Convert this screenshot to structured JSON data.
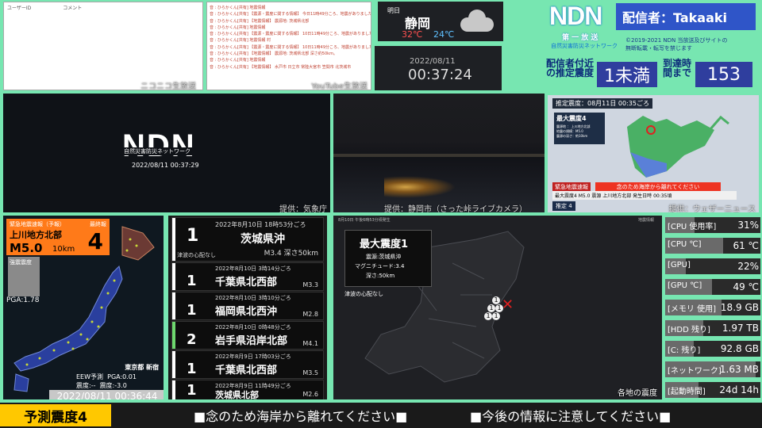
{
  "comments": {
    "headers": [
      "ユーザーID",
      "コメント"
    ],
    "lines": [
      "音 : ひらかくん[共有] 地震情報",
      "音 : ひらかくん[共有] 【震源・震度に関する情報】 今日11時49分ころ、地震がありました。この地震による津波の心配はありません。",
      "音 : ひらかくん[共有] 【地震情報】 震源地: 茨城県北部",
      "音 : ひらかくん[共有] 地震情報",
      "音 : ひらかくん[共有] 【震源・震度に関する情報】 10日11時49分ころ、地震がありました。",
      "音 : ひらかくん[共有] 地震情報 村",
      "音 : ひらかくん[共有] 【震源・震度に関する情報】 10日11時49分ころ、地震がありました。",
      "音 : ひらかくん[共有] 【地震情報】 震源地: 茨城県北部 深さ約50km。",
      "音 : ひらかくん[共有] 地震情報",
      "音 : ひらかくん[共有] 【地震情報】 水戸市 日立市 常陸大宮市 笠間市 北茨城市"
    ],
    "label_niconico": "ニコニコ生放送",
    "label_youtube": "YouTube生放送"
  },
  "weather": {
    "label": "明日",
    "city": "静岡",
    "high": "32℃",
    "low": "24℃"
  },
  "clock": {
    "date": "2022/08/11",
    "time": "00:37:24"
  },
  "ndn": {
    "logo": "NDN",
    "sub": "第 一 放 送",
    "sub2": "自然災害防災ネットワーク",
    "caster": "配信者：Takaaki",
    "copyright1": "©2019-2021 NDN 当放送及びサイトの",
    "copyright2": "無断転載・転写を禁じます",
    "intensity_label": "配信者付近の推定震度",
    "intensity_value": "1未満",
    "arrival_label": "到達時間まで",
    "arrival_value": "153"
  },
  "videos": {
    "ndn_brand": "NDN",
    "ndn_brand_sub": "自然災害防災ネットワーク",
    "ndn_time": "2022/08/11 00:37:29",
    "credit_jma": "提供：気象庁",
    "credit_cam": "提供：静岡市（さった峠ライブカメラ）",
    "credit_wn": "提供：ウェザーニュース"
  },
  "wn_panel": {
    "estimate": "推定震度：08月11日 00:35ごろ",
    "max_label": "最大震度4",
    "line1": "震源地 ： 上川地方北部",
    "line2": "地震の規模：M5.0",
    "line3": "震源の深さ：約10km",
    "banner": "緊急地震速報",
    "msg": "念のため海岸から離れてください",
    "bottom": "最大震度4  M5.0  震源 上川地方北部  発生日時 00:35頃",
    "est": "推定 4"
  },
  "eew": {
    "title": "緊急地震速報（予報）",
    "final": "最終報",
    "area": "上川地方北部",
    "mag": "M5.0",
    "depth": "10km",
    "intensity": "4",
    "int_label": "強震震度",
    "pga": "PGA:1.78",
    "station": "東京都 新宿",
    "eew_pred": "EEW予測",
    "eew_int": "震度:--",
    "pga2": "PGA:0.01",
    "int2": "震度:-3.0",
    "time": "2022/08/11 00:36:44"
  },
  "quakes": [
    {
      "int": "1",
      "date": "2022年8月10日 18時53分ごろ",
      "place": "茨城県沖",
      "mag": "M3.4 深さ50km",
      "note": "津波の心配なし",
      "bar": "#ffffff"
    },
    {
      "int": "1",
      "date": "2022年8月10日 3時14分ごろ",
      "place": "千葉県北西部",
      "mag": "M3.3",
      "bar": "#ffffff"
    },
    {
      "int": "1",
      "date": "2022年8月10日 3時10分ごろ",
      "place": "福岡県北西沖",
      "mag": "M2.8",
      "bar": "#ffffff"
    },
    {
      "int": "2",
      "date": "2022年8月10日 0時48分ごろ",
      "place": "岩手県沿岸北部",
      "mag": "M4.1",
      "bar": "#6ed86e"
    },
    {
      "int": "1",
      "date": "2022年8月9日 17時03分ごろ",
      "place": "千葉県北西部",
      "mag": "M3.5",
      "bar": "#ffffff"
    },
    {
      "int": "1",
      "date": "2022年8月9日 11時49分ごろ",
      "place": "茨城県北部",
      "mag": "M2.6",
      "bar": "#ffffff"
    }
  ],
  "map": {
    "header": "8月10日 午後6時53分頃発生",
    "header2": "地震情報",
    "max": "最大震度1",
    "epi": "震源:茨城県沖",
    "mag": "マグニチュード:3.4",
    "depth": "深さ:50km",
    "tsunami": "津波の心配なし",
    "footer": "各地の震度",
    "marks": [
      "1",
      "1",
      "1",
      "1",
      "1"
    ]
  },
  "stats": [
    {
      "name": "[CPU 使用率]",
      "value": "31%",
      "level": 0.31
    },
    {
      "name": "[CPU ℃]",
      "value": "61 ℃",
      "level": 0.61
    },
    {
      "name": "[GPU]",
      "value": "22%",
      "level": 0.22
    },
    {
      "name": "[GPU ℃]",
      "value": "49 ℃",
      "level": 0.49
    },
    {
      "name": "[メモリ 使用]",
      "value": "18.9 GB",
      "level": 0.59
    },
    {
      "name": "[HDD 残り]",
      "value": "1.97 TB",
      "level": 0.4
    },
    {
      "name": "[C: 残り]",
      "value": "92.8 GB",
      "level": 0.3
    },
    {
      "name": "[ネットワーク]",
      "value": "1.63 MB",
      "level": 0.95
    },
    {
      "name": "[起動時間]",
      "value": "24d 14h",
      "level": 0.35
    }
  ],
  "bottom": {
    "pred": "予測震度4",
    "msg1": "■念のため海岸から離れてください■",
    "msg2": "■今後の情報に注意してください■"
  },
  "colors": {
    "accent": "#77e6b1",
    "eew_orange": "#ff7a19",
    "pred_yellow": "#ffc800",
    "caster_blue": "#2f55c8"
  }
}
